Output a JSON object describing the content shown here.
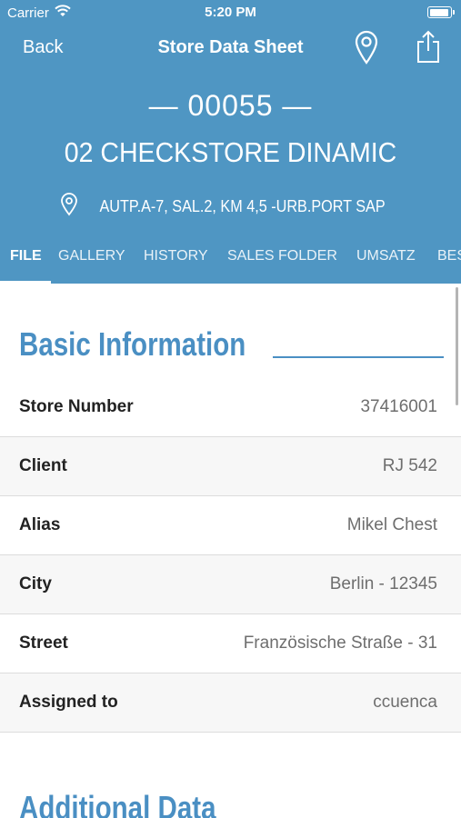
{
  "status_bar": {
    "carrier": "Carrier",
    "time": "5:20 PM"
  },
  "nav": {
    "back_label": "Back",
    "title": "Store Data Sheet",
    "pin_icon": "map-pin-icon",
    "share_icon": "share-icon"
  },
  "store": {
    "code": "— 00055 —",
    "name": "02 CHECKSTORE DINAMIC",
    "address": "AUTP.A-7, SAL.2, KM 4,5 -URB.PORT SAP"
  },
  "tabs": [
    "FILE",
    "GALLERY",
    "HISTORY",
    "SALES FOLDER",
    "UMSATZ",
    "BES"
  ],
  "active_tab": "FILE",
  "basic_info": {
    "title": "Basic Information",
    "rows": [
      {
        "label": "Store Number",
        "value": "37416001"
      },
      {
        "label": "Client",
        "value": "RJ 542"
      },
      {
        "label": "Alias",
        "value": "Mikel Chest"
      },
      {
        "label": "City",
        "value": "Berlin - 12345"
      },
      {
        "label": "Street",
        "value": "Französische Straße - 31"
      },
      {
        "label": "Assigned to",
        "value": "ccuenca"
      }
    ]
  },
  "additional_data": {
    "title": "Additional Data"
  },
  "colors": {
    "header_bg": "#4f96c3",
    "accent": "#4a8fc3"
  }
}
